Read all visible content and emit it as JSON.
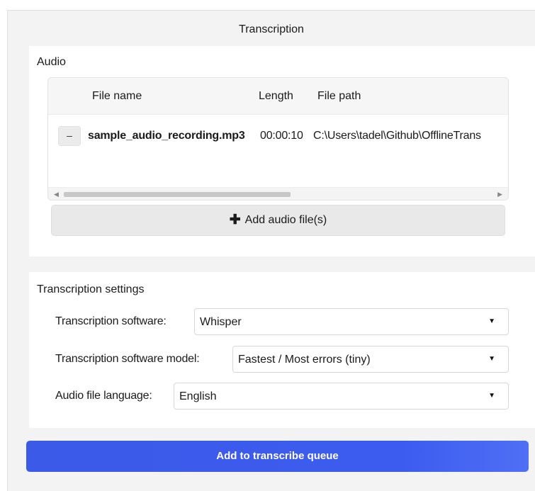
{
  "window": {
    "title": "Transcription"
  },
  "audio": {
    "heading": "Audio",
    "table": {
      "columns": [
        "File name",
        "Length",
        "File path"
      ],
      "rows": [
        {
          "remove_label": "–",
          "file_name": "sample_audio_recording.mp3",
          "length": "00:00:10",
          "file_path": "C:\\Users\\tadel\\Github\\OfflineTrans"
        }
      ],
      "scroll_left_icon": "scroll-left-arrow",
      "scroll_right_icon": "scroll-right-arrow"
    },
    "add_button": {
      "icon": "plus-icon",
      "label": "Add audio file(s)"
    }
  },
  "settings": {
    "heading": "Transcription settings",
    "fields": [
      {
        "label": "Transcription software",
        "value": "Whisper"
      },
      {
        "label": "Transcription software model",
        "value": "Fastest / Most errors (tiny)"
      },
      {
        "label": "Audio file language",
        "value": "English"
      }
    ]
  },
  "queue_button": {
    "label": "Add to transcribe queue",
    "color": "#3c5cf0"
  },
  "colors": {
    "window_bg": "#f3f3f3",
    "card_bg": "#ffffff",
    "accent": "#3c5cf0"
  }
}
